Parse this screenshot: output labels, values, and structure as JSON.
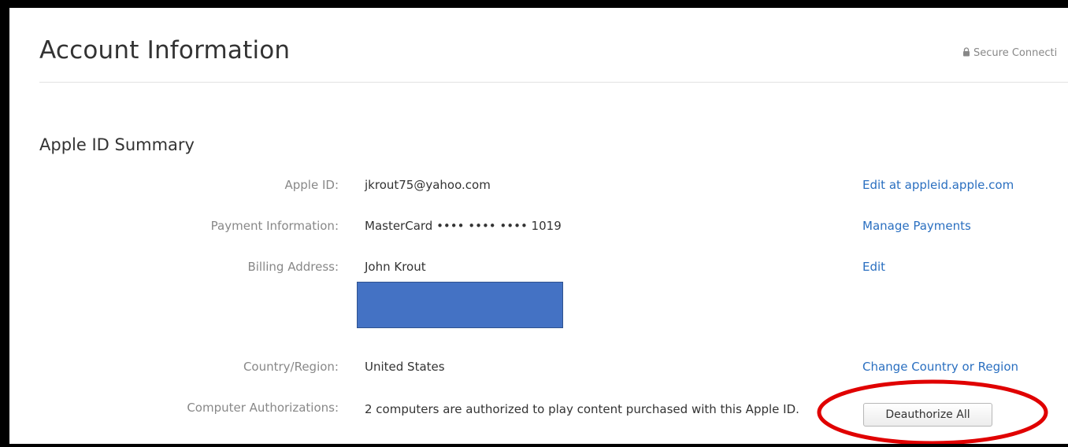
{
  "header": {
    "title": "Account Information",
    "secure_label": "Secure Connecti"
  },
  "section": {
    "title": "Apple ID Summary"
  },
  "rows": {
    "apple_id": {
      "label": "Apple ID:",
      "value": "jkrout75@yahoo.com",
      "action": "Edit at appleid.apple.com"
    },
    "payment": {
      "label": "Payment Information:",
      "value": "MasterCard •••• •••• •••• 1019",
      "action": "Manage Payments"
    },
    "billing": {
      "label": "Billing Address:",
      "value": "John Krout",
      "action": "Edit"
    },
    "country": {
      "label": "Country/Region:",
      "value": "United States",
      "action": "Change Country or Region"
    },
    "authorizations": {
      "label": "Computer Authorizations:",
      "value": "2 computers are authorized to play content purchased with this Apple ID.",
      "button": "Deauthorize All"
    }
  },
  "icons": {
    "secure": "lock-icon"
  },
  "colors": {
    "link": "#2a6fc0",
    "redaction": "#4472c4",
    "annotation": "#e00000"
  }
}
